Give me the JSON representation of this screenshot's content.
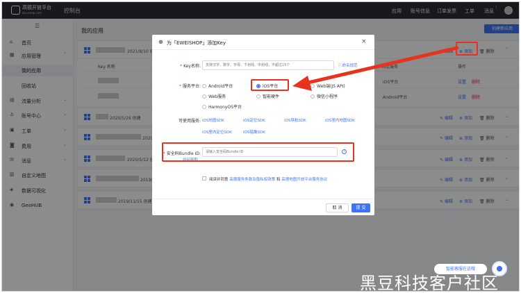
{
  "topbar": {
    "logo_text": "高德开放平台",
    "logo_sub": "lbs.amap.com",
    "console": "控制台",
    "nav": [
      "应用",
      "账号信息",
      "订单发票",
      "工单",
      "消息"
    ],
    "badge": "1"
  },
  "sidebar": {
    "items": [
      {
        "label": "首页",
        "icon": "home-icon"
      },
      {
        "label": "应用管理",
        "icon": "apps-icon",
        "arrow": "^"
      },
      {
        "label": "我的应用",
        "active": true
      },
      {
        "label": "回收站"
      },
      {
        "label": "流量分析",
        "icon": "chart-icon",
        "arrow": "v"
      },
      {
        "label": "账号中心",
        "icon": "user-icon",
        "arrow": "v"
      },
      {
        "label": "工单",
        "icon": "ticket-icon",
        "arrow": "v"
      },
      {
        "label": "费用",
        "icon": "fee-icon",
        "arrow": "v"
      },
      {
        "label": "消息",
        "icon": "message-icon",
        "arrow": "v"
      },
      {
        "label": "自定义地图",
        "icon": "map-icon"
      },
      {
        "label": "数据可视化",
        "icon": "visual-icon"
      },
      {
        "label": "GeoHUB",
        "icon": "geohub-icon"
      }
    ]
  },
  "main": {
    "title": "我的应用",
    "create_button": "创建新应用",
    "apps": [
      {
        "date": "2021/8/10 创建"
      },
      {
        "date": "2020/5/26 创建"
      },
      {
        "date": "2020/5/26 创建"
      },
      {
        "date": "2020/5/12 创建"
      },
      {
        "date": "2019/11/15 创建"
      },
      {
        "date": "2019/11/15 创建"
      }
    ],
    "actions": {
      "edit": "编辑",
      "add": "添加",
      "delete": "删除"
    },
    "table": {
      "col_key": "Key 名称",
      "col_service": "绑定服务",
      "col_op": "操作",
      "rows": [
        {
          "service": "iOS平台",
          "ops": [
            "设置",
            "删除"
          ]
        },
        {
          "service": "Android平台",
          "ops": [
            "设置",
            "删除"
          ]
        }
      ]
    }
  },
  "modal": {
    "title": "为「EWEISHOP」添加Key",
    "key_label": "Key名称:",
    "key_placeholder": "支持汉字、数字、字母、下划线、中划线，不超过15个",
    "naming_link": "命名规范",
    "platform_label": "服务平台:",
    "platforms": [
      "Android平台",
      "iOS平台",
      "Web端(JS API)",
      "Web服务",
      "智能硬件",
      "微信小程序",
      "HarmonyOS平台"
    ],
    "selected_platform": "iOS平台",
    "services_label": "可使用服务:",
    "services": [
      "iOS地图SDK",
      "iOS定位SDK",
      "iOS导航SDK",
      "iOS室内地图SDK",
      "iOS室内定位SDK",
      "iOS猎鹰SDK"
    ],
    "bundle_label": "安全码Bundle ID:",
    "bundle_placeholder": "请输入安全码Bundle ID",
    "bundle_help_link": "如何获取",
    "help_glyph": "?",
    "agree_text": "阅读并同意",
    "agree_link1": "高德服务条款及隐私权政策",
    "agree_and": "和",
    "agree_link2": "高德地图开放平台服务协议",
    "cancel": "取 消",
    "submit": "提 交"
  },
  "widgets": {
    "cs_bubble": "智能客服在这哦",
    "watermark": "黑豆科技客户社区"
  },
  "colors": {
    "accent": "#3f73f6",
    "highlight": "#e8321e",
    "topbar": "#2b2f36"
  }
}
